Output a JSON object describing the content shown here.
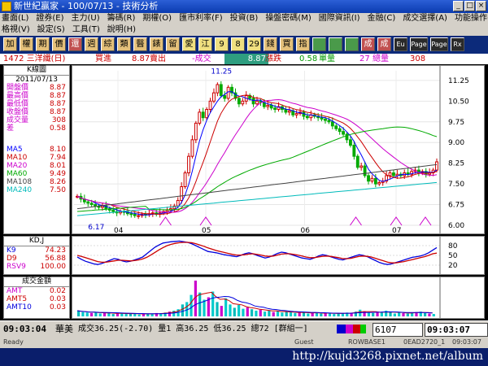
{
  "window": {
    "title": "新世紀贏家 - 100/07/13 - 技術分析",
    "min": "_",
    "max": "□",
    "close": "×"
  },
  "menu": {
    "row1": [
      "畫面(L)",
      "證券(E)",
      "主力(U)",
      "籌碼(R)",
      "期權(O)",
      "匯市利率(F)",
      "投資(B)",
      "操盤密碼(M)",
      "國際資訊(I)",
      "金融(C)",
      "成交選擇(A)",
      "功能操作(E)"
    ],
    "row2": [
      "格視(V)",
      "設定(S)",
      "工具(T)",
      "說明(H)"
    ]
  },
  "toolbar": [
    "加",
    "權",
    "期",
    "價",
    "還",
    "週",
    "綜",
    "類",
    "醫",
    "錶",
    "留",
    "愛",
    "江",
    "9",
    "8",
    "29",
    "錢",
    "買",
    "指",
    "",
    "",
    "",
    "成",
    "成",
    "Eu",
    "Page",
    "Page",
    "Rx"
  ],
  "info": {
    "code_name": "1472 三洋纖(日)",
    "buy_label": "買進",
    "buy": "8.87",
    "sell_label": "賣出",
    "chg_label": "-成交",
    "last": "8.87",
    "chg_label2": "漲跌",
    "change": "0.58",
    "vol_label": "單量",
    "total": "27",
    "total_label": "總量",
    "total_vol": "308"
  },
  "kpanel": {
    "title": "K線圖",
    "date": "2011/07/13",
    "rows": [
      {
        "label": "開盤價",
        "value": "8.87"
      },
      {
        "label": "最高價",
        "value": "8.87"
      },
      {
        "label": "最低價",
        "value": "8.87"
      },
      {
        "label": "收盤價",
        "value": "8.87"
      },
      {
        "label": "成交量",
        "value": "308"
      },
      {
        "label": "差",
        "value": "0.58"
      }
    ],
    "ma": [
      {
        "label": "MA5",
        "value": "8.10",
        "color": "#0000ff"
      },
      {
        "label": "MA10",
        "value": "7.94",
        "color": "#cc0000"
      },
      {
        "label": "MA20",
        "value": "8.01",
        "color": "#cc00cc"
      },
      {
        "label": "MA60",
        "value": "9.49",
        "color": "#00aa00"
      },
      {
        "label": "MA108",
        "value": "8.26",
        "color": "#444444"
      },
      {
        "label": "MA240",
        "value": "7.50",
        "color": "#00bbbb"
      }
    ]
  },
  "kdpanel": {
    "title": "KD,J",
    "rows": [
      {
        "label": "K9",
        "value": "74.23"
      },
      {
        "label": "D9",
        "value": "56.88"
      },
      {
        "label": "RSV9",
        "value": "100.00"
      }
    ]
  },
  "amtpanel": {
    "title": "成交金額",
    "rows": [
      {
        "label": "AMT",
        "value": "0.02"
      },
      {
        "label": "AMT5",
        "value": "0.03"
      },
      {
        "label": "AMT10",
        "value": "0.03"
      }
    ]
  },
  "chart_data": [
    {
      "type": "candlestick",
      "x_ticks": [
        "04",
        "05",
        "06",
        "07"
      ],
      "y_ticks": [
        "11.25",
        "10.50",
        "9.75",
        "9.00",
        "8.25",
        "7.50",
        "6.75",
        "6.00"
      ],
      "ylim": [
        6.0,
        11.6
      ],
      "max_label": "11.25",
      "min_label": "6.17",
      "close": [
        7.05,
        6.95,
        6.85,
        6.8,
        6.75,
        6.7,
        6.65,
        6.7,
        6.6,
        6.55,
        6.5,
        6.45,
        6.5,
        6.48,
        6.42,
        6.4,
        6.35,
        6.35,
        6.4,
        6.38,
        6.42,
        6.45,
        6.4,
        6.45,
        6.5,
        6.55,
        6.6,
        6.7,
        6.9,
        7.4,
        7.9,
        8.5,
        9.1,
        9.7,
        10.1,
        9.9,
        10.2,
        10.5,
        10.8,
        11.1,
        10.7,
        10.6,
        11.0,
        10.8,
        10.6,
        10.4,
        10.5,
        10.7,
        10.6,
        10.4,
        10.5,
        10.45,
        10.3,
        10.35,
        10.25,
        10.2,
        10.3,
        10.2,
        10.1,
        10.15,
        10.0,
        10.05,
        10.1,
        9.95,
        9.9,
        10.0,
        9.95,
        9.9,
        9.85,
        9.8,
        9.75,
        9.6,
        9.5,
        9.4,
        9.3,
        9.1,
        8.9,
        8.5,
        8.1,
        8.15,
        7.8,
        7.6,
        7.7,
        7.5,
        7.55,
        7.6,
        7.8,
        7.9,
        7.8,
        7.85,
        7.8,
        7.9,
        7.85,
        7.95,
        8.0,
        7.9,
        7.95,
        7.85,
        7.9,
        8.0,
        8.3
      ]
    },
    {
      "type": "line",
      "y_ticks": [
        "80",
        "50",
        "20"
      ],
      "ylim": [
        0,
        100
      ],
      "series": [
        {
          "name": "K9",
          "color": "#0000dd",
          "values": [
            45,
            38,
            32,
            28,
            24,
            22,
            25,
            30,
            35,
            40,
            38,
            33,
            30,
            32,
            36,
            40,
            45,
            55,
            65,
            75,
            82,
            88,
            90,
            92,
            93,
            94,
            92,
            90,
            86,
            80,
            74,
            68,
            62,
            60,
            58,
            55,
            52,
            50,
            48,
            46,
            50,
            55,
            58,
            55,
            50,
            46,
            42,
            45,
            50,
            56,
            60,
            58,
            54,
            50,
            46,
            42,
            40,
            38,
            42,
            48,
            52,
            50,
            46,
            42,
            38,
            36,
            40,
            44,
            48,
            52,
            50,
            46,
            40,
            34,
            28,
            24,
            22,
            24,
            28,
            32,
            36,
            40,
            44,
            46,
            48,
            52,
            58,
            66,
            74
          ]
        },
        {
          "name": "D9",
          "color": "#cc0000",
          "values": [
            50,
            47,
            43,
            39,
            35,
            31,
            29,
            29,
            31,
            33,
            35,
            35,
            34,
            33,
            34,
            36,
            39,
            44,
            51,
            59,
            67,
            74,
            80,
            84,
            87,
            89,
            90,
            90,
            89,
            86,
            82,
            78,
            73,
            69,
            65,
            62,
            59,
            56,
            53,
            51,
            51,
            52,
            54,
            55,
            53,
            51,
            48,
            47,
            48,
            51,
            54,
            55,
            55,
            53,
            51,
            48,
            45,
            43,
            43,
            45,
            47,
            48,
            47,
            45,
            43,
            40,
            40,
            41,
            44,
            47,
            48,
            47,
            45,
            41,
            37,
            33,
            29,
            27,
            27,
            29,
            31,
            34,
            37,
            40,
            43,
            46,
            50,
            55,
            57
          ]
        }
      ]
    },
    {
      "type": "bar",
      "values": [
        1.2,
        0.9,
        0.8,
        0.7,
        0.9,
        0.6,
        0.8,
        0.7,
        0.5,
        0.6,
        0.7,
        0.5,
        0.6,
        0.6,
        0.4,
        0.5,
        0.6,
        0.5,
        0.7,
        0.6,
        0.8,
        1.0,
        1.2,
        1.5,
        2.5,
        3.0,
        4.5,
        7.5,
        5.0,
        3.5,
        4.0,
        5.2,
        3.0,
        2.2,
        3.8,
        2.5,
        1.8,
        2.4,
        1.6,
        1.9,
        1.5,
        1.2,
        1.4,
        1.0,
        1.3,
        0.9,
        1.1,
        0.8,
        1.0,
        0.9,
        0.7,
        0.8,
        0.9,
        0.6,
        0.7,
        0.8,
        0.6,
        0.7,
        0.6,
        0.5,
        0.7,
        0.6,
        0.8,
        0.7,
        1.0,
        1.4,
        1.1,
        0.8,
        0.7,
        0.9,
        0.8,
        1.2,
        0.9,
        0.6,
        0.8,
        0.7,
        0.6,
        0.8,
        0.9,
        1.0,
        0.7,
        0.6,
        0.5
      ]
    }
  ],
  "status": {
    "time": "09:03:04",
    "name": "華美",
    "text": "成交36.25(-2.70) 量1 高36.25 低36.25 總72 [群組一]",
    "code": "6107",
    "clock": "09:03:07"
  },
  "bottom": {
    "left": "Ready",
    "guest": "Guest",
    "row": "ROWBASE1",
    "id": "0EAD2720_1",
    "time": "09:03:07"
  },
  "taskbar": {
    "url": "http://kujd3268.pixnet.net/album"
  }
}
